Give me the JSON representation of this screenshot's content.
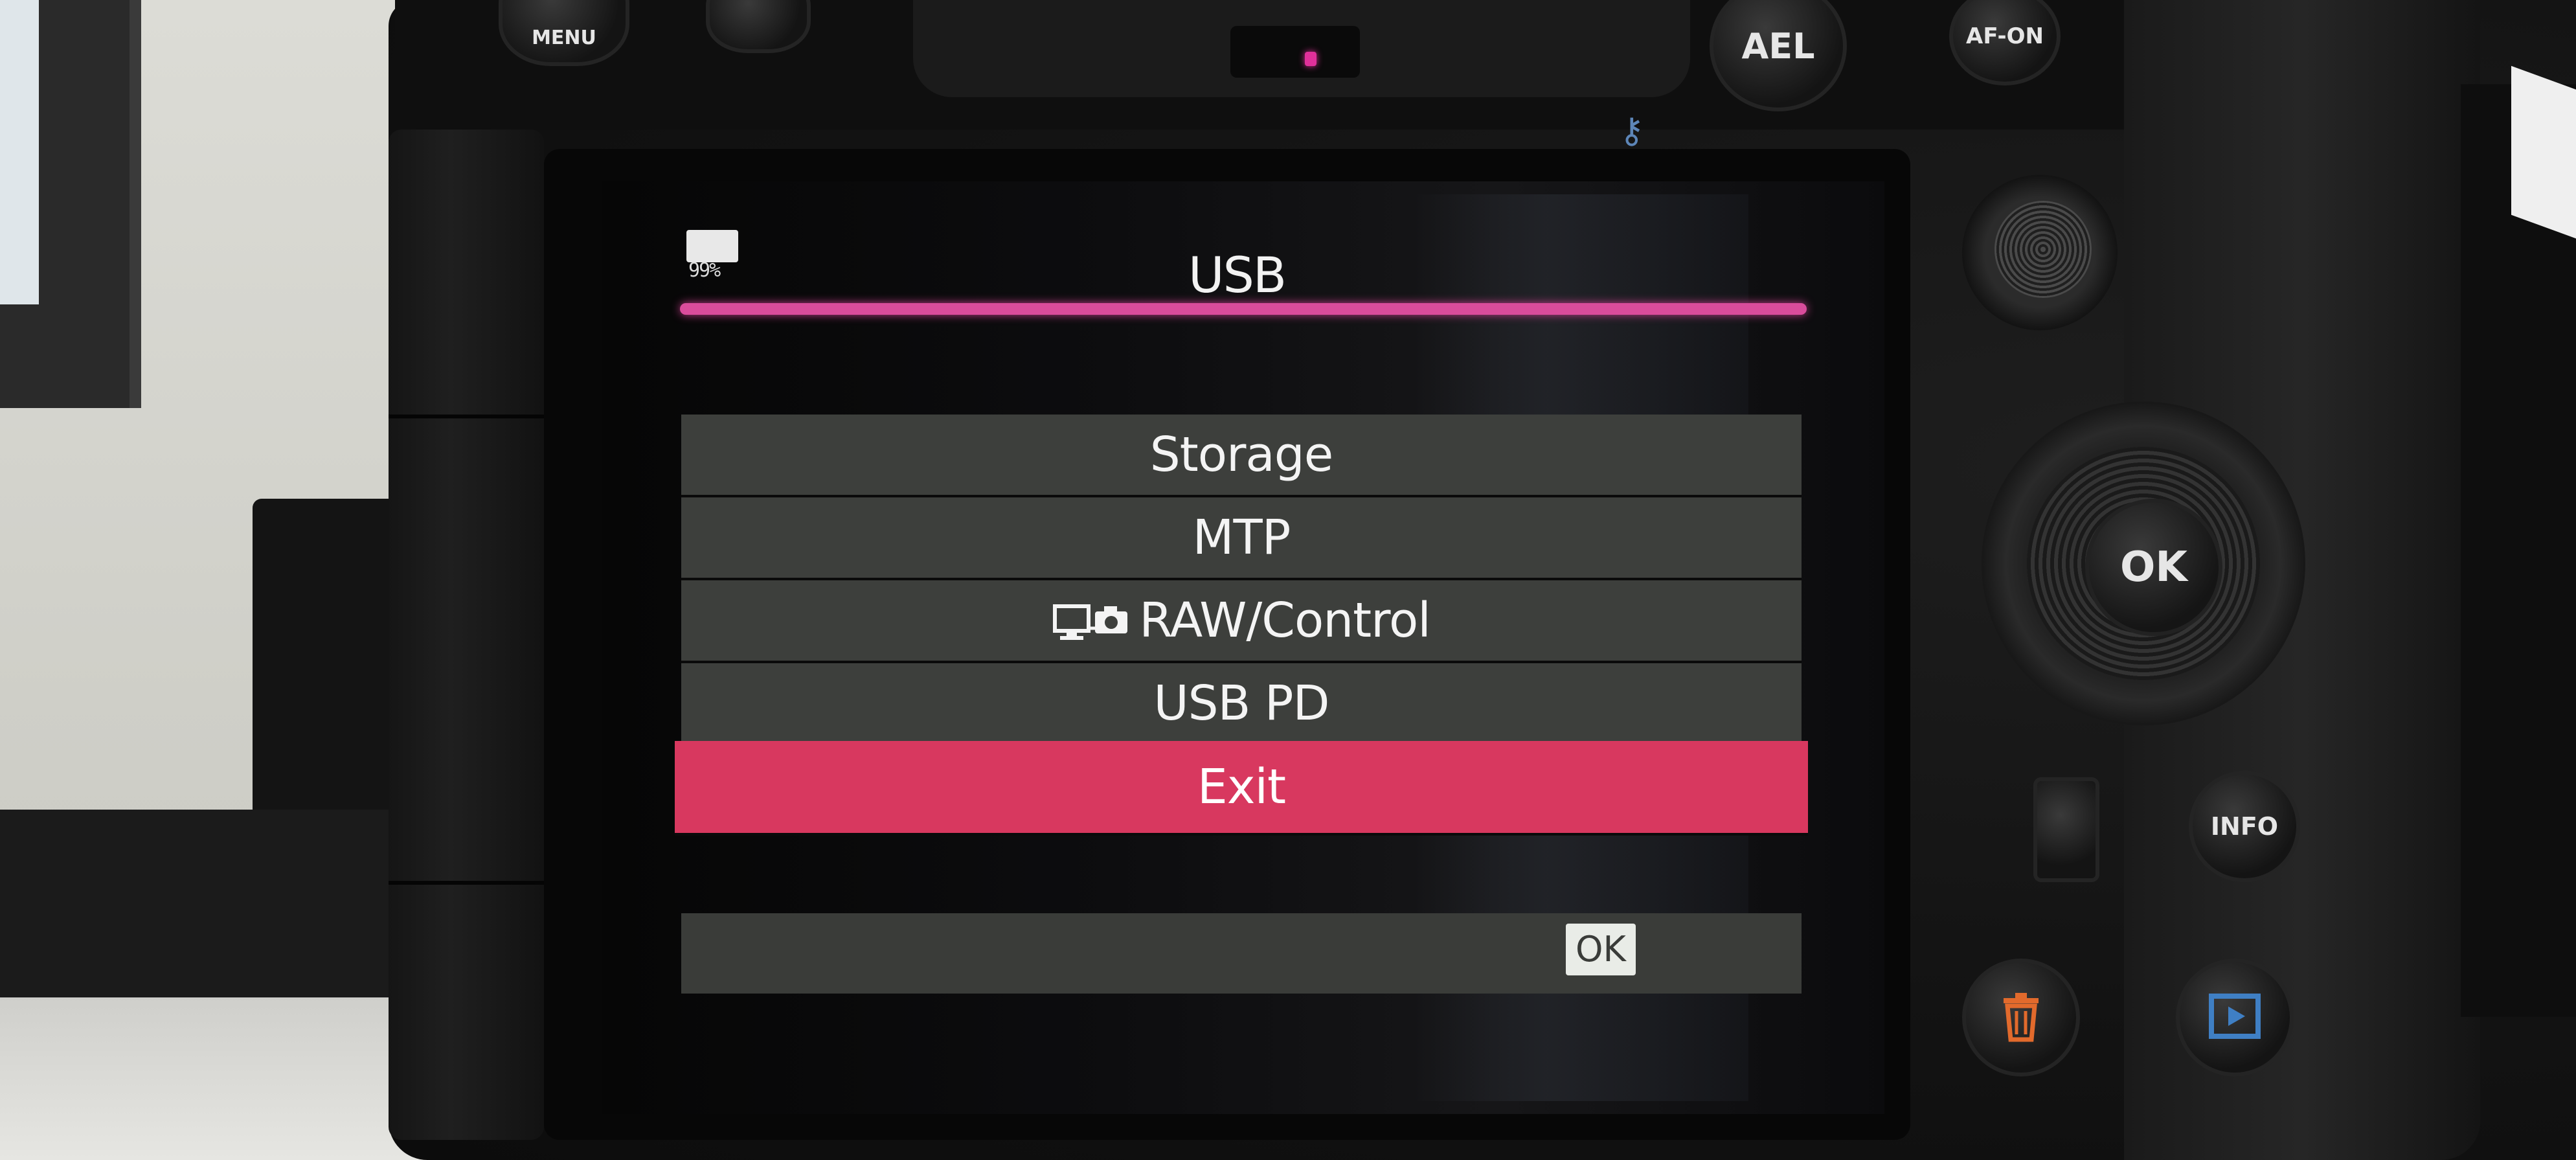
{
  "camera": {
    "buttons": {
      "menu": "MENU",
      "ael": "AEL",
      "af_on": "AF-ON",
      "ok": "OK",
      "info": "INFO"
    }
  },
  "screen": {
    "battery_percent": "99%",
    "title": "USB",
    "menu_items": [
      {
        "label": "Storage",
        "icon": null,
        "selected": false
      },
      {
        "label": "MTP",
        "icon": null,
        "selected": false
      },
      {
        "label": "RAW/Control",
        "icon": "pc-camera-icon",
        "selected": false
      },
      {
        "label": "USB PD",
        "icon": null,
        "selected": false
      },
      {
        "label": "Exit",
        "icon": null,
        "selected": true
      }
    ],
    "footer_hint": "OK"
  },
  "colors": {
    "accent_line": "#d94c9b",
    "selected_item": "#d8385f",
    "item_bg": "#3d3f3c",
    "delete_button": "#e26a2c",
    "play_button": "#3f7fc4"
  }
}
